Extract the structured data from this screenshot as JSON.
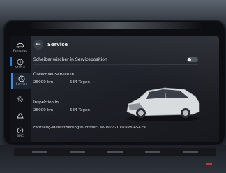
{
  "rail": {
    "items": [
      {
        "label": "Fahrzeug",
        "icon": "car-icon"
      },
      {
        "label": "Status",
        "icon": "info-icon"
      },
      {
        "label": "Service",
        "icon": "clock-icon"
      },
      {
        "label": "",
        "icon": "gear-icon"
      },
      {
        "label": "",
        "icon": "drive-icon"
      },
      {
        "label": "BMC",
        "icon": "steering-icon"
      }
    ]
  },
  "header": {
    "back_icon": "back-arrow-icon",
    "title": "Service"
  },
  "wiper_row": {
    "label": "Scheibenwischer in Serviceposition",
    "toggle_on": false
  },
  "oil_service": {
    "title": "Ölwechsel-Service in",
    "distance": "26000 km",
    "days": "534 Tagen"
  },
  "inspection": {
    "title": "Inspektion in",
    "distance": "26000 km",
    "days": "534 Tagen"
  },
  "vin_line": "Fahrzeug-Identifizierungsnummer: WVWZZZCD7RW045429",
  "colors": {
    "accent": "#3d8bd6",
    "screen_bg": "#1c1f25",
    "car_body": "#d9dcdf"
  }
}
